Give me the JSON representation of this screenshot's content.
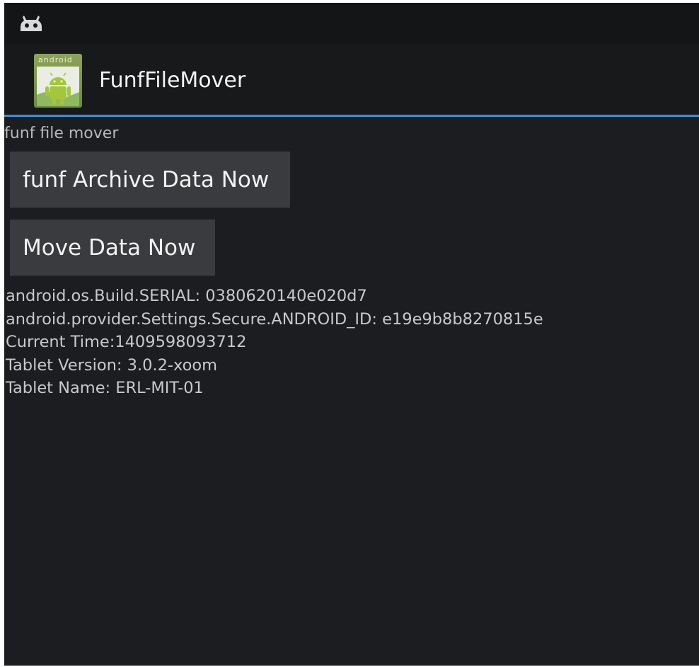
{
  "app": {
    "title": "FunfFileMover",
    "icon_label": "android"
  },
  "main": {
    "subtitle": "funf file mover",
    "archive_button_label": "funf Archive Data Now",
    "move_button_label": "Move Data Now",
    "info_lines": [
      "android.os.Build.SERIAL: 0380620140e020d7",
      "android.provider.Settings.Secure.ANDROID_ID: e19e9b8b8270815e",
      "Current Time:1409598093712",
      "Tablet Version: 3.0.2-xoom",
      "Tablet Name: ERL-MIT-01"
    ]
  },
  "colors": {
    "background": "#1c1d20",
    "accent_divider": "#3e8ed9",
    "button_bg": "#3a3b3e"
  },
  "icons": {
    "status_notification": "cyanogenmod-icon",
    "app_launcher": "android-app-icon"
  }
}
